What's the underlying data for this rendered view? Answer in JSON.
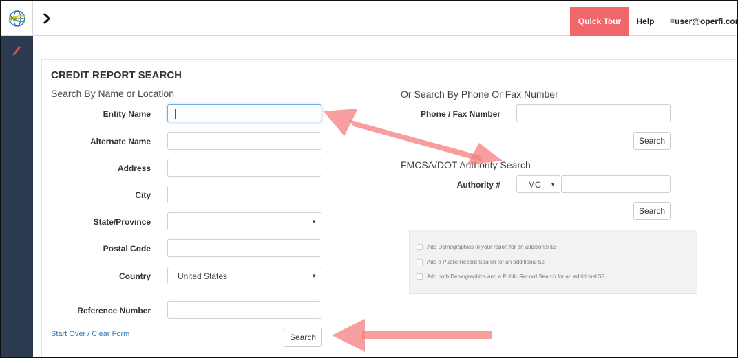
{
  "header": {
    "quick_tour": "Quick Tour",
    "help": "Help",
    "user": "≡user@operfi.com"
  },
  "form": {
    "title": "CREDIT REPORT SEARCH",
    "left_heading": "Search By Name or Location",
    "fields": {
      "entity_name": "Entity Name",
      "alternate_name": "Alternate Name",
      "address": "Address",
      "city": "City",
      "state": "State/Province",
      "postal": "Postal Code",
      "country": "Country",
      "country_value": "United States",
      "reference": "Reference Number"
    },
    "clear_link": "Start Over / Clear Form",
    "search_button": "Search"
  },
  "phone": {
    "heading": "Or Search By Phone Or Fax Number",
    "label": "Phone / Fax Number",
    "search_button": "Search"
  },
  "fmcsa": {
    "heading": "FMCSA/DOT Authority Search",
    "label": "Authority #",
    "type_value": "MC",
    "search_button": "Search"
  },
  "addons": [
    "Add Demographics to your report for an additional $3",
    "Add a Public Record Search for an additional $2",
    "Add both Demographics and a Public Record Search for an additional $5"
  ],
  "colors": {
    "accent": "#f0666a",
    "sidebar": "#2c3a4f",
    "link": "#337ab7",
    "arrow": "#f47f7f"
  },
  "icons": {
    "logo": "globe-logo-icon",
    "menu": "chevron-right-icon",
    "sidebar": "pencil-icon"
  }
}
